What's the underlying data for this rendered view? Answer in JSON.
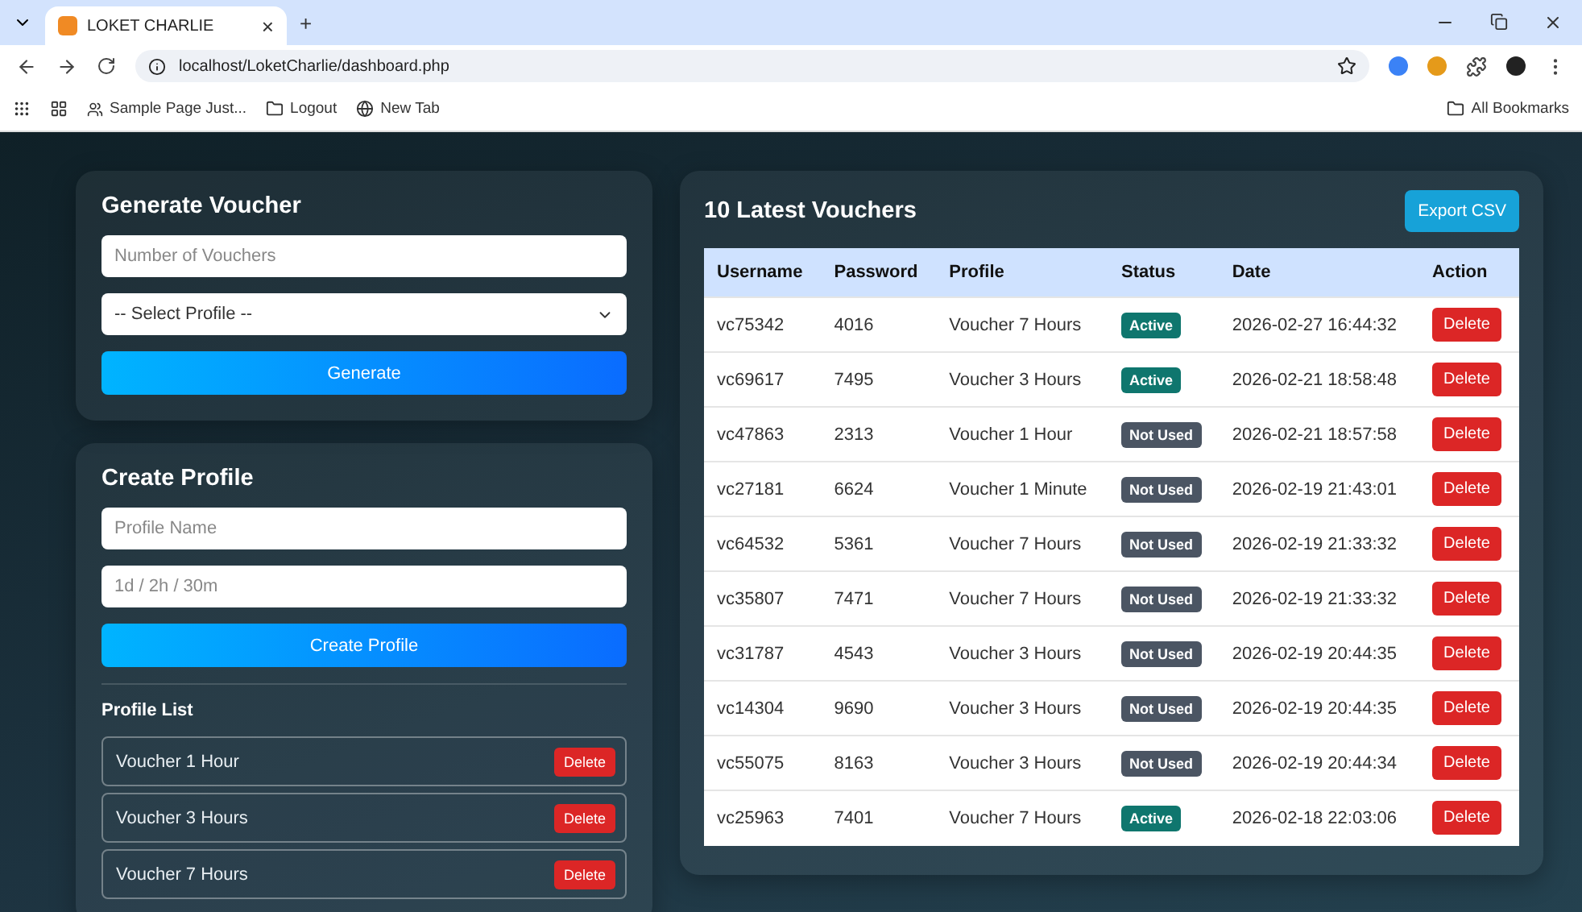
{
  "browser": {
    "tab_title": "LOKET CHARLIE",
    "tab_close": "×",
    "new_tab": "+",
    "url": "localhost/LoketCharlie/dashboard.php",
    "bookmarks": [
      "Sample Page Just...",
      "Logout",
      "New Tab"
    ],
    "all_bookmarks": "All Bookmarks"
  },
  "generate_voucher": {
    "title": "Generate Voucher",
    "count_placeholder": "Number of Vouchers",
    "profile_select": "-- Select Profile --",
    "button": "Generate"
  },
  "create_profile": {
    "title": "Create Profile",
    "name_placeholder": "Profile Name",
    "duration_placeholder": "1d / 2h / 30m",
    "button": "Create Profile",
    "list_title": "Profile List",
    "profiles": [
      {
        "name": "Voucher 1 Hour",
        "delete": "Delete"
      },
      {
        "name": "Voucher 3 Hours",
        "delete": "Delete"
      },
      {
        "name": "Voucher 7 Hours",
        "delete": "Delete"
      }
    ]
  },
  "vouchers": {
    "title": "10 Latest Vouchers",
    "export_button": "Export CSV",
    "columns": [
      "Username",
      "Password",
      "Profile",
      "Status",
      "Date",
      "Action"
    ],
    "rows": [
      {
        "username": "vc75342",
        "password": "4016",
        "profile": "Voucher 7 Hours",
        "status": {
          "text": "Active",
          "kind": "active"
        },
        "date": "2026-02-27 16:44:32",
        "action": "Delete"
      },
      {
        "username": "vc69617",
        "password": "7495",
        "profile": "Voucher 3 Hours",
        "status": {
          "text": "Active",
          "kind": "active"
        },
        "date": "2026-02-21 18:58:48",
        "action": "Delete"
      },
      {
        "username": "vc47863",
        "password": "2313",
        "profile": "Voucher 1 Hour",
        "status": {
          "text": "Not Used",
          "kind": "not_used"
        },
        "date": "2026-02-21 18:57:58",
        "action": "Delete"
      },
      {
        "username": "vc27181",
        "password": "6624",
        "profile": "Voucher 1 Minute",
        "status": {
          "text": "Not Used",
          "kind": "not_used"
        },
        "date": "2026-02-19 21:43:01",
        "action": "Delete"
      },
      {
        "username": "vc64532",
        "password": "5361",
        "profile": "Voucher 7 Hours",
        "status": {
          "text": "Not Used",
          "kind": "not_used"
        },
        "date": "2026-02-19 21:33:32",
        "action": "Delete"
      },
      {
        "username": "vc35807",
        "password": "7471",
        "profile": "Voucher 7 Hours",
        "status": {
          "text": "Not Used",
          "kind": "not_used"
        },
        "date": "2026-02-19 21:33:32",
        "action": "Delete"
      },
      {
        "username": "vc31787",
        "password": "4543",
        "profile": "Voucher 3 Hours",
        "status": {
          "text": "Not Used",
          "kind": "not_used"
        },
        "date": "2026-02-19 20:44:35",
        "action": "Delete"
      },
      {
        "username": "vc14304",
        "password": "9690",
        "profile": "Voucher 3 Hours",
        "status": {
          "text": "Not Used",
          "kind": "not_used"
        },
        "date": "2026-02-19 20:44:35",
        "action": "Delete"
      },
      {
        "username": "vc55075",
        "password": "8163",
        "profile": "Voucher 3 Hours",
        "status": {
          "text": "Not Used",
          "kind": "not_used"
        },
        "date": "2026-02-19 20:44:34",
        "action": "Delete"
      },
      {
        "username": "vc25963",
        "password": "7401",
        "profile": "Voucher 7 Hours",
        "status": {
          "text": "Active",
          "kind": "active"
        },
        "date": "2026-02-18 22:03:06",
        "action": "Delete"
      }
    ]
  }
}
